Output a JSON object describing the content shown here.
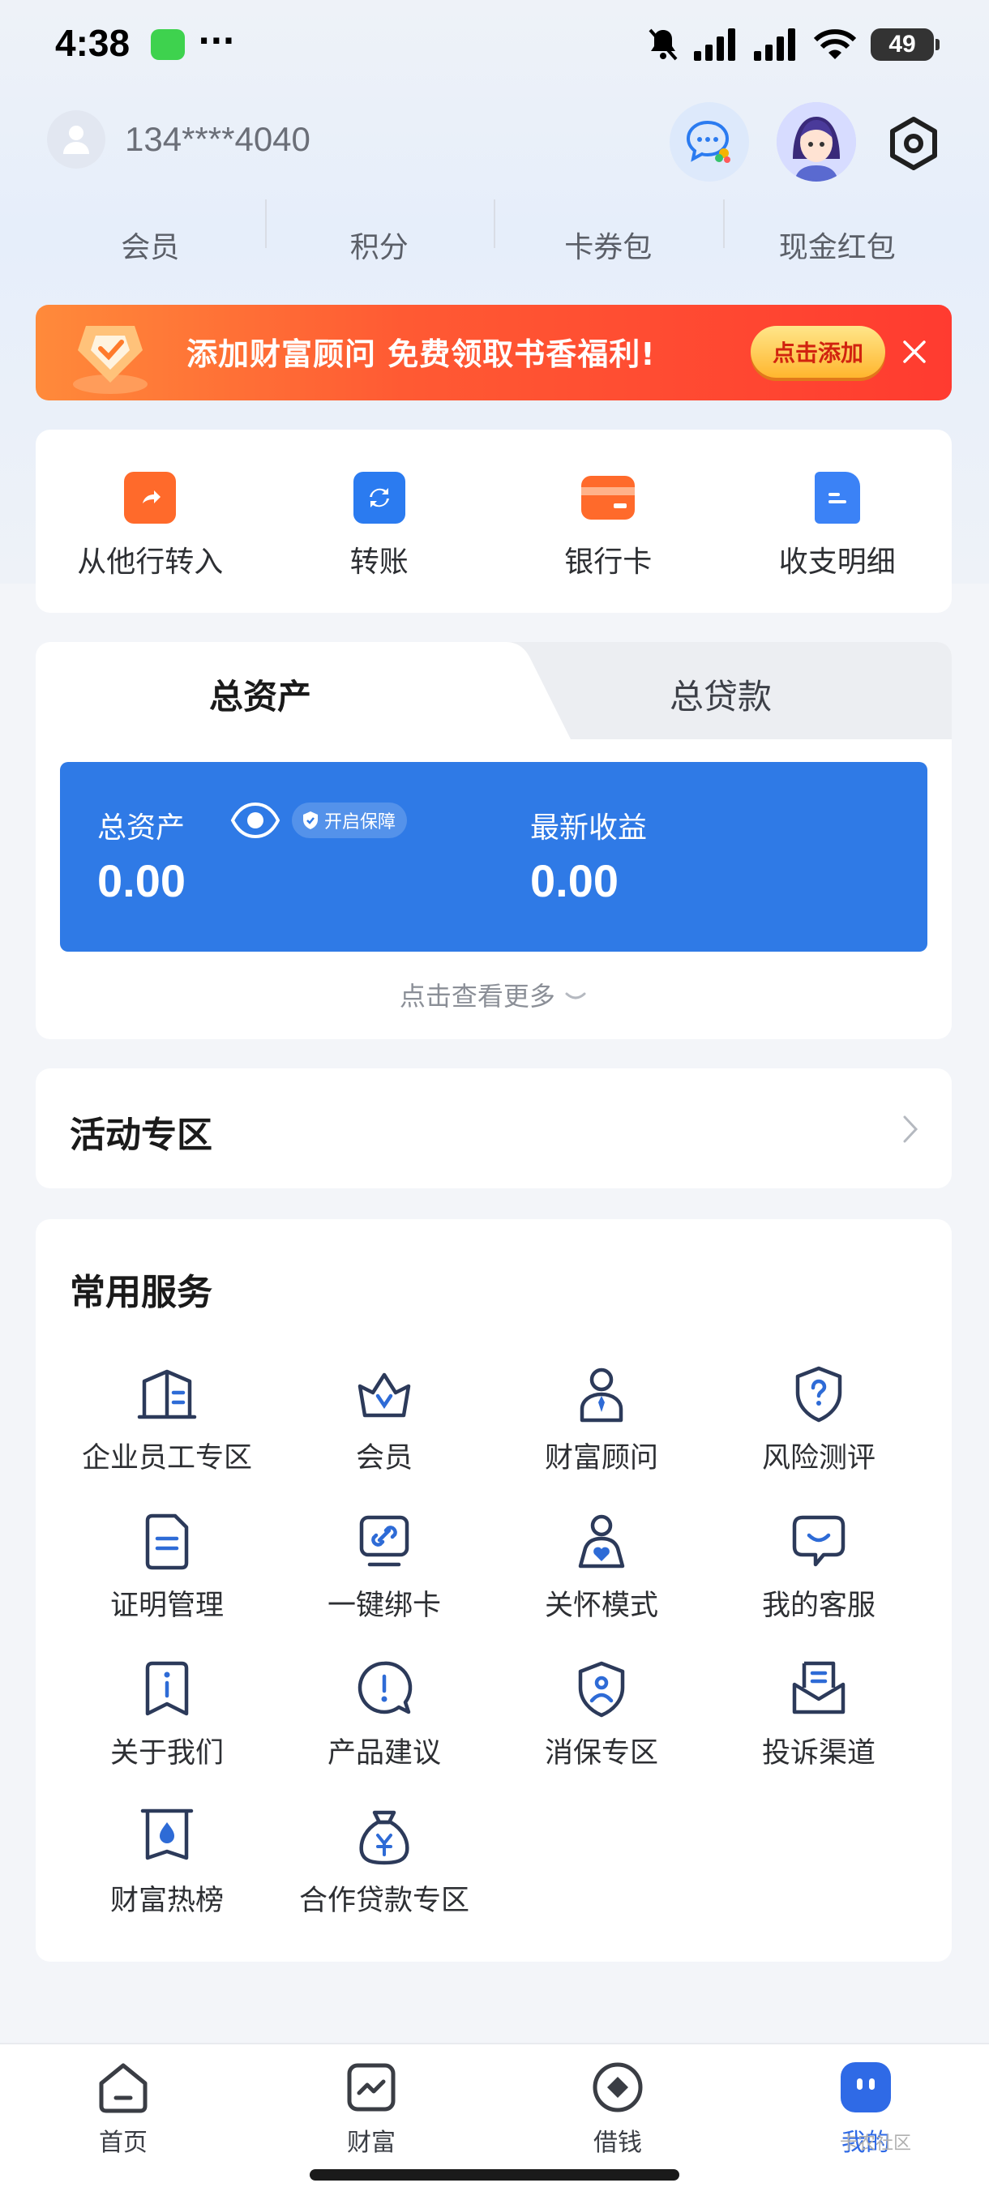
{
  "status_bar": {
    "time": "4:38",
    "dots": "···",
    "battery": "49"
  },
  "header": {
    "phone": "134****4040"
  },
  "stats": [
    "会员",
    "积分",
    "卡券包",
    "现金红包"
  ],
  "banner": {
    "text": "添加财富顾问 免费领取书香福利!",
    "button": "点击添加"
  },
  "quick_actions": [
    {
      "label": "从他行转入",
      "icon": "transfer-in-icon",
      "color": "#ff6a2b"
    },
    {
      "label": "转账",
      "icon": "transfer-icon",
      "color": "#2b7bf0"
    },
    {
      "label": "银行卡",
      "icon": "bank-card-icon",
      "color": "#ff6a2b"
    },
    {
      "label": "收支明细",
      "icon": "statement-icon",
      "color": "#3b82f6"
    }
  ],
  "assets": {
    "tab_assets": "总资产",
    "tab_loans": "总贷款",
    "total_label": "总资产",
    "protect": "开启保障",
    "total_value": "0.00",
    "income_label": "最新收益",
    "income_value": "0.00",
    "more": "点击查看更多"
  },
  "activity": {
    "title": "活动专区"
  },
  "services": {
    "title": "常用服务",
    "items": [
      {
        "label": "企业员工专区",
        "icon": "building-icon"
      },
      {
        "label": "会员",
        "icon": "crown-icon"
      },
      {
        "label": "财富顾问",
        "icon": "advisor-icon"
      },
      {
        "label": "风险测评",
        "icon": "shield-question-icon"
      },
      {
        "label": "证明管理",
        "icon": "document-icon"
      },
      {
        "label": "一键绑卡",
        "icon": "link-card-icon"
      },
      {
        "label": "关怀模式",
        "icon": "care-icon"
      },
      {
        "label": "我的客服",
        "icon": "customer-service-icon"
      },
      {
        "label": "关于我们",
        "icon": "info-icon"
      },
      {
        "label": "产品建议",
        "icon": "suggestion-icon"
      },
      {
        "label": "消保专区",
        "icon": "consumer-protection-icon"
      },
      {
        "label": "投诉渠道",
        "icon": "complaint-icon"
      },
      {
        "label": "财富热榜",
        "icon": "hot-list-icon"
      },
      {
        "label": "合作贷款专区",
        "icon": "loan-bag-icon"
      }
    ]
  },
  "bottom_nav": [
    {
      "label": "首页",
      "icon": "home-icon"
    },
    {
      "label": "财富",
      "icon": "wealth-icon"
    },
    {
      "label": "借钱",
      "icon": "borrow-icon"
    },
    {
      "label": "我的",
      "icon": "profile-icon",
      "active": true
    }
  ],
  "watermark": "卡农社区",
  "colors": {
    "primary": "#2f7ae6",
    "accent": "#ff5a33",
    "icon_stroke": "#2c3a5a"
  }
}
